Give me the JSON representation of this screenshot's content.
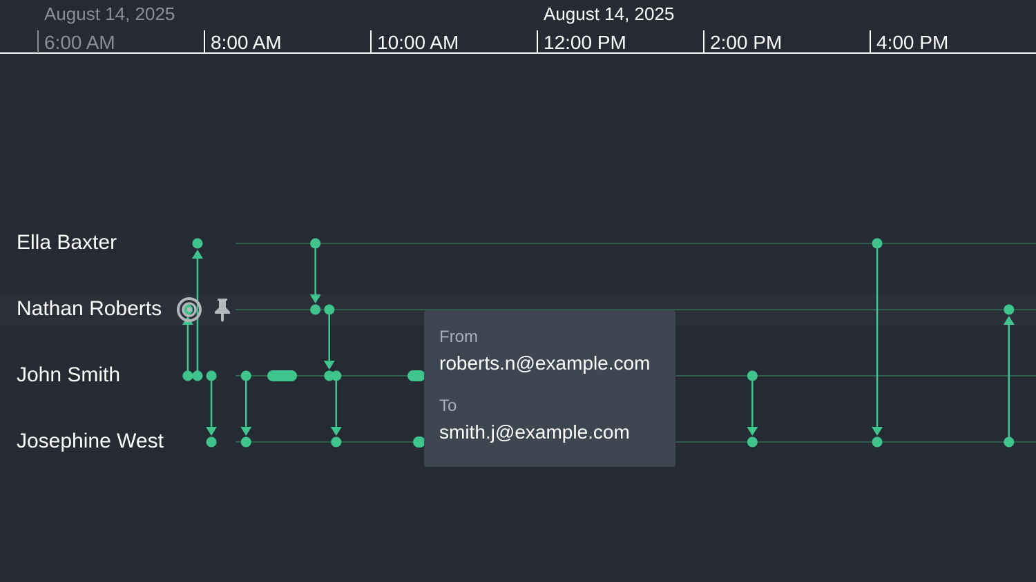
{
  "header": {
    "left_date": "August 14, 2025",
    "center_date": "August 14, 2025",
    "ticks": [
      "6:00 AM",
      "8:00 AM",
      "10:00 AM",
      "12:00 PM",
      "2:00 PM",
      "4:00 PM"
    ]
  },
  "people": [
    {
      "name": "Ella Baxter"
    },
    {
      "name": "Nathan Roberts",
      "highlighted": true
    },
    {
      "name": "John Smith"
    },
    {
      "name": "Josephine West"
    }
  ],
  "icons": {
    "focus": "target-icon",
    "pin": "pin-icon"
  },
  "events": [
    {
      "time": "7:48 AM",
      "from": "John Smith",
      "to": "Nathan Roberts"
    },
    {
      "time": "7:55 AM",
      "from": "John Smith",
      "to": "Ella Baxter"
    },
    {
      "time": "8:05 AM",
      "from": "John Smith",
      "to": "Josephine West"
    },
    {
      "time": "8:30 AM",
      "from": "John Smith",
      "to": "Josephine West"
    },
    {
      "time": "9:20 AM",
      "from": "Ella Baxter",
      "to": "Nathan Roberts"
    },
    {
      "time": "9:30 AM",
      "from": "Nathan Roberts",
      "to": "John Smith"
    },
    {
      "time": "9:35 AM",
      "from": "John Smith",
      "to": "Josephine West"
    },
    {
      "time": "2:35 PM",
      "from": "John Smith",
      "to": "Josephine West"
    },
    {
      "time": "4:05 PM",
      "from": "Ella Baxter",
      "to": "Josephine West"
    },
    {
      "time": "5:40 PM",
      "from": "Josephine West",
      "to": "Nathan Roberts"
    }
  ],
  "tooltip": {
    "from_label": "From",
    "from_value": "roberts.n@example.com",
    "to_label": "To",
    "to_value": "smith.j@example.com"
  },
  "colors": {
    "background": "#262b33",
    "accent": "#3ec48c",
    "lane": "#2f5c4c",
    "highlight_band": "#2b3038",
    "tooltip_bg": "#3d4651"
  }
}
